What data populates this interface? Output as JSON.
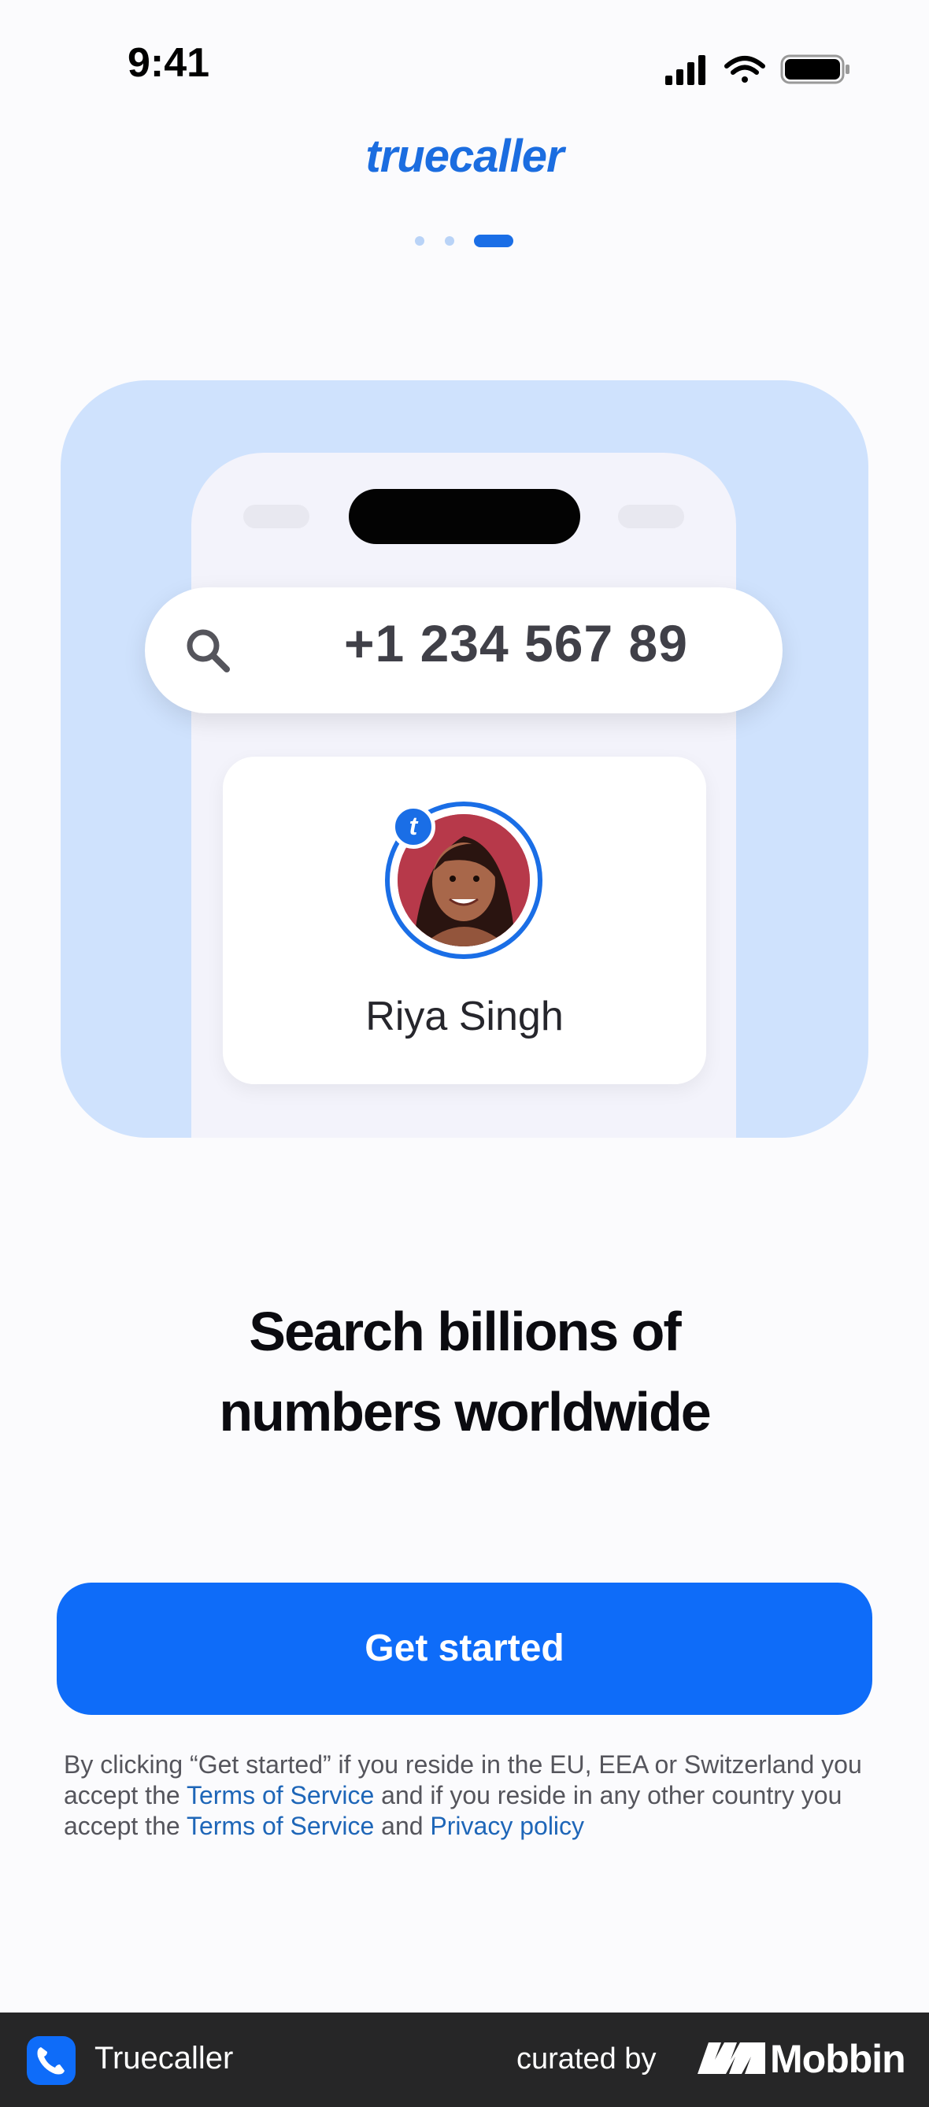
{
  "status_bar": {
    "time": "9:41",
    "icons": [
      "signal-icon",
      "wifi-icon",
      "battery-icon"
    ]
  },
  "brand": {
    "logo_text": "truecaller",
    "color": "#1b6de0"
  },
  "pager": {
    "count": 3,
    "active_index": 2
  },
  "illustration": {
    "search_number": "+1 234 567 89",
    "badge_letter": "t",
    "contact_name": "Riya Singh"
  },
  "headline": {
    "line1": "Search billions of",
    "line2": "numbers worldwide"
  },
  "cta": {
    "label": "Get started",
    "color": "#0e6cf9"
  },
  "legal": {
    "part1": "By clicking “Get started” if you reside in the EU, EEA or Switzerland you accept the ",
    "link1": "Terms of Service",
    "part2": " and if you reside in any other country you accept the ",
    "link2": "Terms of Service",
    "part3": " and ",
    "link3": "Privacy policy"
  },
  "footer": {
    "app_name": "Truecaller",
    "curated_by": "curated by",
    "brand": "Mobbin"
  }
}
